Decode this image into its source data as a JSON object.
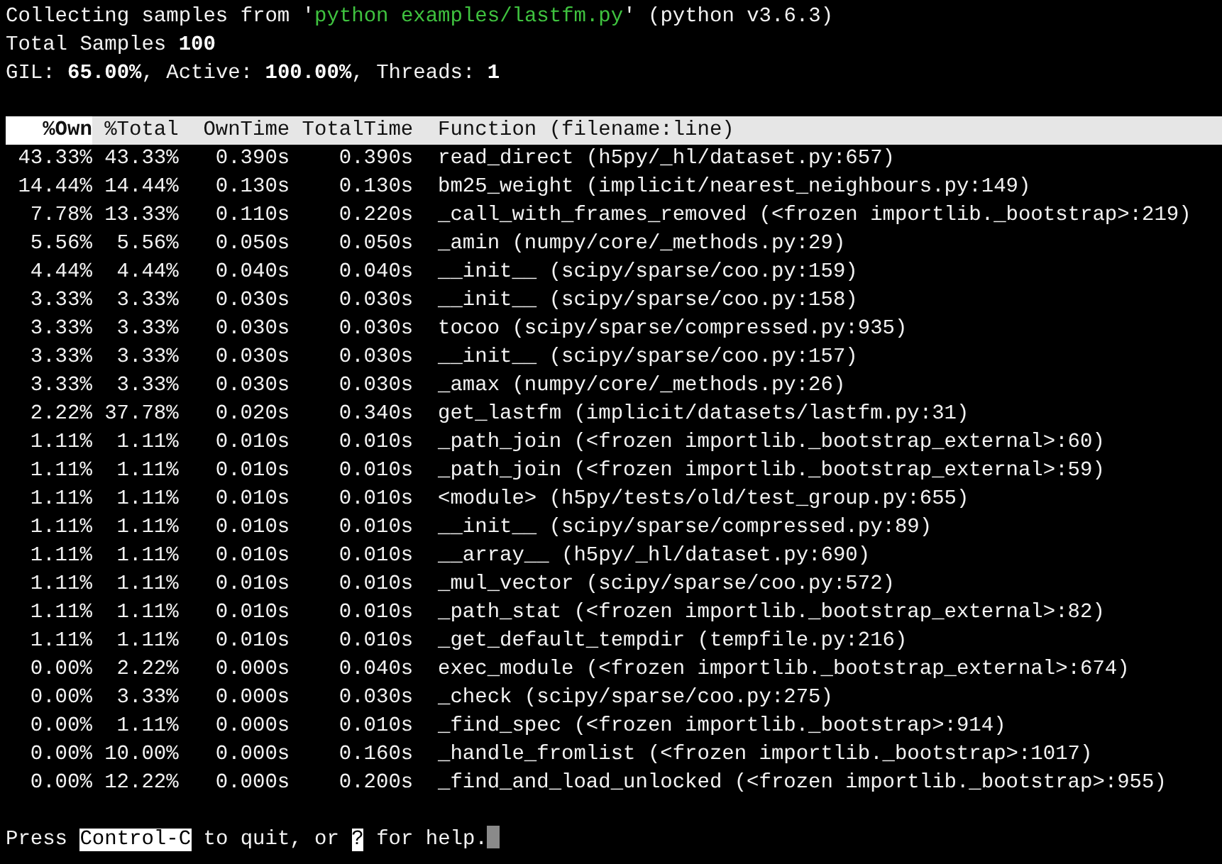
{
  "status": {
    "line_1": {
      "before": "Collecting samples from '",
      "program": "python examples/lastfm.py",
      "after": "' (python v3.6.3)"
    },
    "line_2": "Total Samples **100**",
    "line_3": "GIL: **65.00%**, Active: **100.00%**, Threads: **1**"
  },
  "table": {
    "columns": [
      {
        "label": "%Own",
        "selected": true
      },
      {
        "label": "%Total",
        "selected": false
      },
      {
        "label": "OwnTime",
        "selected": false
      },
      {
        "label": "TotalTime",
        "selected": false
      },
      {
        "label": "Function (filename:line)",
        "selected": false
      }
    ],
    "rows": [
      [
        "43.33%",
        "43.33%",
        "0.390s",
        "0.390s",
        "read_direct (h5py/_hl/dataset.py:657)"
      ],
      [
        "14.44%",
        "14.44%",
        "0.130s",
        "0.130s",
        "bm25_weight (implicit/nearest_neighbours.py:149)"
      ],
      [
        "7.78%",
        "13.33%",
        "0.110s",
        "0.220s",
        "_call_with_frames_removed (<frozen importlib._bootstrap>:219)"
      ],
      [
        "5.56%",
        "5.56%",
        "0.050s",
        "0.050s",
        "_amin (numpy/core/_methods.py:29)"
      ],
      [
        "4.44%",
        "4.44%",
        "0.040s",
        "0.040s",
        "__init__ (scipy/sparse/coo.py:159)"
      ],
      [
        "3.33%",
        "3.33%",
        "0.030s",
        "0.030s",
        "__init__ (scipy/sparse/coo.py:158)"
      ],
      [
        "3.33%",
        "3.33%",
        "0.030s",
        "0.030s",
        "tocoo (scipy/sparse/compressed.py:935)"
      ],
      [
        "3.33%",
        "3.33%",
        "0.030s",
        "0.030s",
        "__init__ (scipy/sparse/coo.py:157)"
      ],
      [
        "3.33%",
        "3.33%",
        "0.030s",
        "0.030s",
        "_amax (numpy/core/_methods.py:26)"
      ],
      [
        "2.22%",
        "37.78%",
        "0.020s",
        "0.340s",
        "get_lastfm (implicit/datasets/lastfm.py:31)"
      ],
      [
        "1.11%",
        "1.11%",
        "0.010s",
        "0.010s",
        "_path_join (<frozen importlib._bootstrap_external>:60)"
      ],
      [
        "1.11%",
        "1.11%",
        "0.010s",
        "0.010s",
        "_path_join (<frozen importlib._bootstrap_external>:59)"
      ],
      [
        "1.11%",
        "1.11%",
        "0.010s",
        "0.010s",
        "<module> (h5py/tests/old/test_group.py:655)"
      ],
      [
        "1.11%",
        "1.11%",
        "0.010s",
        "0.010s",
        "__init__ (scipy/sparse/compressed.py:89)"
      ],
      [
        "1.11%",
        "1.11%",
        "0.010s",
        "0.010s",
        "__array__ (h5py/_hl/dataset.py:690)"
      ],
      [
        "1.11%",
        "1.11%",
        "0.010s",
        "0.010s",
        "_mul_vector (scipy/sparse/coo.py:572)"
      ],
      [
        "1.11%",
        "1.11%",
        "0.010s",
        "0.010s",
        "_path_stat (<frozen importlib._bootstrap_external>:82)"
      ],
      [
        "1.11%",
        "1.11%",
        "0.010s",
        "0.010s",
        "_get_default_tempdir (tempfile.py:216)"
      ],
      [
        "0.00%",
        "2.22%",
        "0.000s",
        "0.040s",
        "exec_module (<frozen importlib._bootstrap_external>:674)"
      ],
      [
        "0.00%",
        "3.33%",
        "0.000s",
        "0.030s",
        "_check (scipy/sparse/coo.py:275)"
      ],
      [
        "0.00%",
        "1.11%",
        "0.000s",
        "0.010s",
        "_find_spec (<frozen importlib._bootstrap>:914)"
      ],
      [
        "0.00%",
        "10.00%",
        "0.000s",
        "0.160s",
        "_handle_fromlist (<frozen importlib._bootstrap>:1017)"
      ],
      [
        "0.00%",
        "12.22%",
        "0.000s",
        "0.200s",
        "_find_and_load_unlocked (<frozen importlib._bootstrap>:955)"
      ]
    ]
  },
  "footer": [
    {
      "kind": "text",
      "text": "Press "
    },
    {
      "kind": "key",
      "text": "Control-C"
    },
    {
      "kind": "text",
      "text": " to quit, or "
    },
    {
      "kind": "key",
      "text": "?"
    },
    {
      "kind": "text",
      "text": " for help."
    },
    {
      "kind": "cursor"
    }
  ]
}
